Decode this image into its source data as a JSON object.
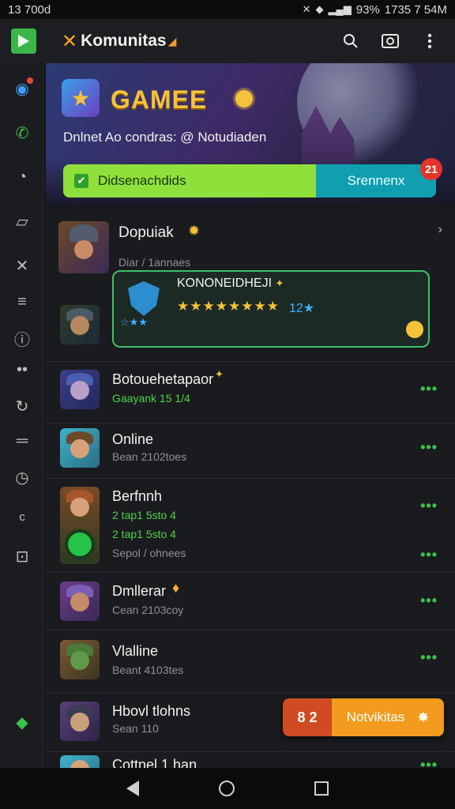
{
  "status_bar": {
    "time": "13 700d",
    "battery": "93%",
    "clock_right": "1735 7 54M"
  },
  "app_bar": {
    "title": "Komunitas"
  },
  "banner": {
    "game_title": "GAMEE",
    "subtitle": "Dnlnet Ao condras: @ Notudiaden",
    "download_left": "Didsenachdids",
    "download_right": "Srennenx",
    "badge": "21"
  },
  "list": {
    "first": {
      "name": "Dopuiak",
      "sub": "Diar / 1annaes"
    },
    "featured": {
      "title": "KONONEIDHEJI",
      "stars": "★★★★★★★★",
      "count": "12★",
      "shield_stars": "☆★★"
    },
    "rows": [
      {
        "name": "Botouehetapaor",
        "sub": "Gaayank 15 1/4"
      },
      {
        "name": "Online",
        "sub": "Bean 2102toes"
      },
      {
        "name": "Berfnnh",
        "sub_green_1": "2 tap1 5sto 4",
        "sub_green_2": "2 tap1 5sto 4",
        "sub": "Sepol / ohnees"
      },
      {
        "name": "Dmllerar",
        "sub": "Cean 2103coy"
      },
      {
        "name": "Vlalline",
        "sub": "Beant 4103tes"
      },
      {
        "name": "Hbovl tlohns",
        "sub": "Sean 110"
      },
      {
        "name": "Cottnel 1 han"
      }
    ]
  },
  "fab": {
    "left_label": "8 2",
    "right_label": "Notvikitas"
  }
}
